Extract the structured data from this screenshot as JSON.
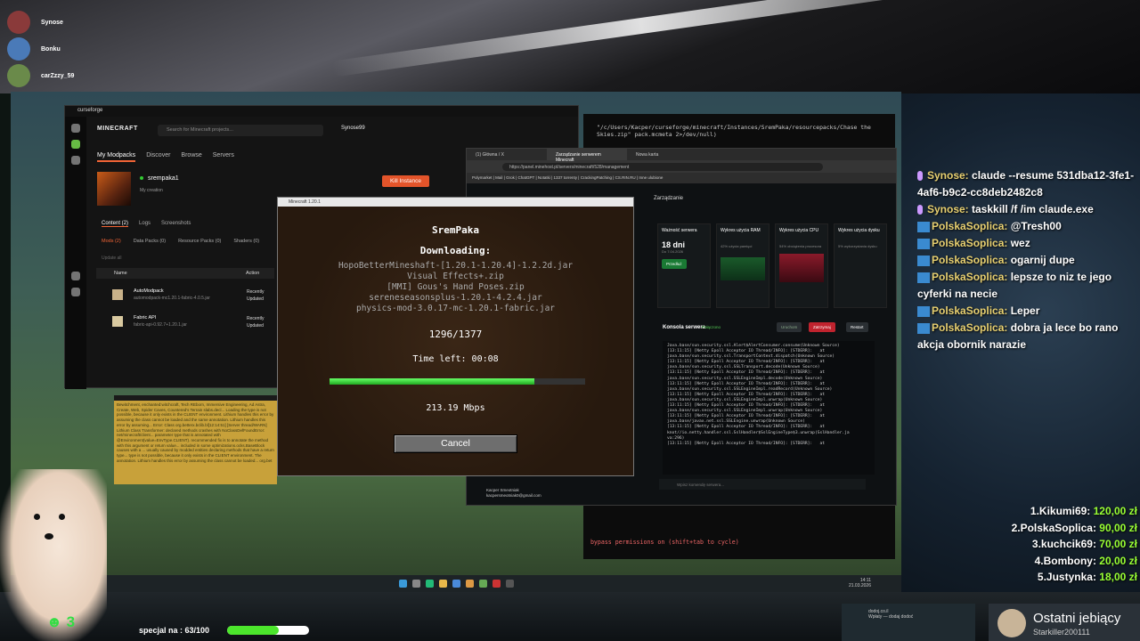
{
  "viewers": [
    "Synose",
    "Bonku",
    "carZzzy_59"
  ],
  "curseforge": {
    "app_title": "curseforge",
    "logo": "MINECRAFT",
    "search_placeholder": "Search for Minecraft projects...",
    "user": "Synose99",
    "nav": [
      "My Modpacks",
      "Discover",
      "Browse",
      "Servers"
    ],
    "instance_name": "srempaka1",
    "instance_sub": "My creation",
    "kill_button": "Kill Instance",
    "tabs": [
      "Content (2)",
      "Logs",
      "Screenshots"
    ],
    "filters": [
      "Mods (2)",
      "Data Packs (0)",
      "Resource Packs (0)",
      "Shaders (0)"
    ],
    "update_all": "Update all",
    "col_name": "Name",
    "col_action": "Action",
    "mods": [
      {
        "name": "AutoModpack",
        "file": "automodpack-mc1.20.1-fabric-4.0.5.jar",
        "status": "Recently Updated"
      },
      {
        "name": "Fabric API",
        "file": "fabric-api-0.92.7+1.20.1.jar",
        "status": "Recently Updated"
      }
    ]
  },
  "log_text": "Bewitchment, enchanted:witchcraft, Tech REborn, Immersive Engineering, Ad Astra, Create, Web, Spider Caves, Countered's Terrain slabs.decl... Loading the type is not possible, because it only exists in the CLIENT environment. Lithium handles this error by assuming the class cannot be loaded and the same annotation. Lithium handles this error by assuming... Error: Class org.betterx.bclib.bl[12:14:51] [Server thread/WARN] Lithium Class Transformer: declared methods crashes with NoClassDefFoundError: net/minecraft/client... parameter type that is annotated with @Environment(value=EnvType.CLIENT). recommended fix is to annotate the method with this argument or return value... included in some optimizations.ocks.BaseBlock causes with a ... usually caused by modded entities declaring methods that have a return type... type is not possible, because it only exists in the CLIENT environment. The annotation. Lithium handles this error by assuming the class cannot be loaded... org.bet",
  "minecraft": {
    "window_title": "Minecraft 1.20.1",
    "title": "SremPaka",
    "downloading": "Downloading:",
    "files": [
      "HopoBetterMineshaft-[1.20.1-1.20.4]-1.2.2d.jar",
      "Visual Effects+.zip",
      "[MMI] Gous's Hand Poses.zip",
      "sereneseasonsplus-1.20.1-4.2.4.jar",
      "physics-mod-3.0.17-mc-1.20.1-fabric.jar"
    ],
    "count": "1296/1377",
    "progress": 0.8,
    "time_left": "Time left: 00:08",
    "speed": "213.19 Mbps",
    "cancel": "Cancel"
  },
  "browser": {
    "tabs": [
      "(1) Główna / X",
      "Zarządzanie serwerem Minecraft",
      "Nowa karta"
    ],
    "url": "https://panel.minehost.pl/servers/minecraft/528/management",
    "bookmarks": "Polymarket | Mail | Grok | ChatGPT | Notatki | 1337 torrenty | CrackingPatching | CS.RIN.RU | Inne ulubione",
    "section": "Zarządzanie",
    "cards": [
      {
        "title": "Ważność serwera",
        "value": "18 dni",
        "sub": "Do 7.04.2026",
        "btn": "Przedłuż"
      },
      {
        "title": "Wykres użycia RAM",
        "value": "",
        "sub": "42% użycia pamięci",
        "btn": ""
      },
      {
        "title": "Wykres użycia CPU",
        "value": "",
        "sub": "54% obciążenia procesora",
        "btn": ""
      },
      {
        "title": "Wykres użycia dysku",
        "value": "",
        "sub": "5% wykorzystania dysku",
        "btn": ""
      }
    ],
    "console_title": "Konsola serwera",
    "console_status": "Połączono",
    "btn_start": "Uruchom",
    "btn_stop": "Zatrzymaj",
    "btn_restart": "Restart",
    "console_lines": "Java.base/sun.security.ssl.Alert$AlertConsumer.consume(Unknown Source)\n[13:11:15] [Netty Epoll Acceptor IO Thread/INFO]: [STDERR]:   at\njava.base/sun.security.ssl.TransportContext.dispatch(Unknown Source)\n[13:11:15] [Netty Epoll Acceptor IO Thread/INFO]: [STDERR]:   at\njava.base/sun.security.ssl.SSLTransport.decode(Unknown Source)\n[13:11:15] [Netty Epoll Acceptor IO Thread/INFO]: [STDERR]:   at\njava.base/sun.security.ssl.SSLEngineImpl.decode(Unknown Source)\n[13:11:15] [Netty Epoll Acceptor IO Thread/INFO]: [STDERR]:   at\njava.base/sun.security.ssl.SSLEngineImpl.readRecord(Unknown Source)\n[13:11:15] [Netty Epoll Acceptor IO Thread/INFO]: [STDERR]:   at\njava.base/sun.security.ssl.SSLEngineImpl.unwrap(Unknown Source)\n[13:11:15] [Netty Epoll Acceptor IO Thread/INFO]: [STDERR]:   at\njava.base/sun.security.ssl.SSLEngineImpl.unwrap(Unknown Source)\n[13:11:15] [Netty Epoll Acceptor IO Thread/INFO]: [STDERR]:   at\njava.base/javax.net.ssl.SSLEngine.unwrap(Unknown Source)\n[13:11:15] [Netty Epoll Acceptor IO Thread/INFO]: [STDERR]:   at\nknot//io.netty.handler.ssl.SslHandler$SslEngineType$3.unwrap(SslHandler.ja\nva:296)\n[13:11:15] [Netty Epoll Acceptor IO Thread/INFO]: [STDERR]:   at",
    "command_placeholder": "Wpisz komendę serwera...",
    "account_name": "Kacper Smeotniak",
    "account_email": "kacpersmeotniak0@gmail.com"
  },
  "terminal": {
    "path": "\"/c/Users/Kacper/curseforge/minecraft/Instances/SremPaka/resourcepacks/Chase the Skies.zip\" pack.mcmeta 2>/dev/null)",
    "bypass": "  bypass permissions on (shift+tab to cycle)"
  },
  "chat": [
    {
      "name": "Synose",
      "text": "claude --resume 531dba12-3fe1-4af6-b9c2-cc8deb2482c8",
      "type": "mic"
    },
    {
      "name": "Synose",
      "text": "taskkill /f /im claude.exe",
      "type": "mic"
    },
    {
      "name": "PolskaSoplica",
      "text": "@Tresh00",
      "type": "badge"
    },
    {
      "name": "PolskaSoplica",
      "text": "wez",
      "type": "badge"
    },
    {
      "name": "PolskaSoplica",
      "text": "ogarnij dupe",
      "type": "badge"
    },
    {
      "name": "PolskaSoplica",
      "text": "lepsze to niz te jego cyferki na necie",
      "type": "badge"
    },
    {
      "name": "PolskaSoplica",
      "text": "Leper",
      "type": "badge"
    },
    {
      "name": "PolskaSoplica",
      "text": "dobra ja lece bo rano akcja obornik narazie",
      "type": "badge"
    }
  ],
  "donations": [
    {
      "name": "1.Kikumi69:",
      "value": "120,00 zł"
    },
    {
      "name": "2.PolskaSoplica:",
      "value": "90,00 zł"
    },
    {
      "name": "3.kuchcik69:",
      "value": "70,00 zł"
    },
    {
      "name": "4.Bombony:",
      "value": "20,00 zł"
    },
    {
      "name": "5.Justynka:",
      "value": "18,00 zł"
    }
  ],
  "likes": "3",
  "special_label": "specjal na : 63/100",
  "special_progress": 0.63,
  "song": {
    "title": "dodoj.co.il",
    "sub": "Wpłaty — dodaj dodoć"
  },
  "last_sub": {
    "title": "Ostatni jebiący",
    "user": "Starkiller200111"
  },
  "clock": {
    "time": "14:11",
    "date": "21.03.2026"
  }
}
